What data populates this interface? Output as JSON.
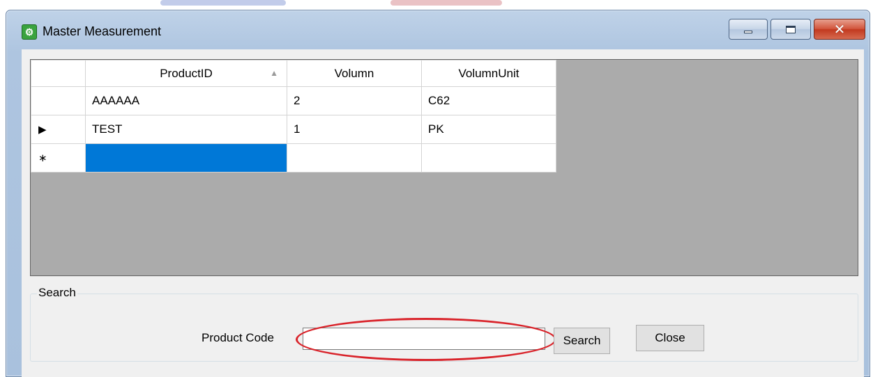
{
  "window": {
    "title": "Master Measurement",
    "close_glyph": "✕"
  },
  "grid": {
    "columns": [
      "ProductID",
      "Volumn",
      "VolumnUnit"
    ],
    "sort_indicator": "▲",
    "rows": [
      {
        "marker": "",
        "cells": [
          "AAAAAA",
          "2",
          "C62"
        ]
      },
      {
        "marker": "▶",
        "cells": [
          "TEST",
          "1",
          "PK"
        ]
      },
      {
        "marker": "∗",
        "cells": [
          "",
          "",
          ""
        ]
      }
    ]
  },
  "search": {
    "group_label": "Search",
    "product_code_label": "Product Code",
    "product_code_value": "",
    "search_button": "Search",
    "close_button": "Close"
  },
  "colors": {
    "selection": "#0078d7",
    "highlight_ring": "#d9232a",
    "grid_background": "#ababab"
  }
}
